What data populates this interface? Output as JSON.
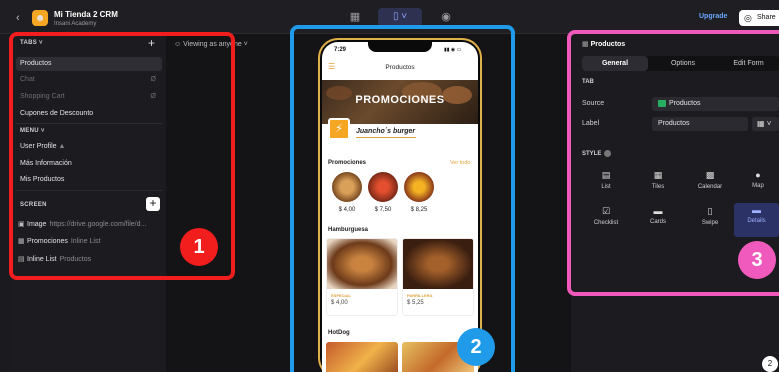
{
  "topbar": {
    "app_title": "Mi Tienda 2 CRM",
    "app_subtitle": "Insani Academy",
    "upgrade": "Upgrade",
    "share": "Share"
  },
  "left": {
    "tabs_header": "TABS",
    "tabs": [
      {
        "label": "Productos",
        "selected": true,
        "hidden": false
      },
      {
        "label": "Chat",
        "hidden": true
      },
      {
        "label": "Shopping Cart",
        "hidden": true
      },
      {
        "label": "Cupones de Descounto",
        "hidden": false
      }
    ],
    "menu_header": "MENU",
    "menu": [
      {
        "label": "User Profile"
      },
      {
        "label": "Más Información"
      },
      {
        "label": "Mis Productos"
      }
    ],
    "screen_header": "SCREEN",
    "screen": [
      {
        "label": "Image",
        "sub": "https://drive.google.com/file/d..."
      },
      {
        "label": "Promociones",
        "sub": "Inline List"
      },
      {
        "label": "Inline List",
        "sub": "Productos"
      }
    ]
  },
  "viewing": "Viewing as anyone",
  "phone": {
    "time": "7:29",
    "title": "Productos",
    "banner": "PROMOCIONES",
    "brand": "Juancho´s burger",
    "promo_header": "Promociones",
    "see_all": "Ver todo",
    "prices": [
      "$ 4,00",
      "$ 7,50",
      "$ 8,25"
    ],
    "hamburguesa_header": "Hamburguesa",
    "cards": [
      {
        "tag": "ESPECIAL",
        "price": "$ 4,00"
      },
      {
        "tag": "PARRILLERA",
        "price": "$ 5,25"
      }
    ],
    "hotdog_header": "HotDog"
  },
  "right": {
    "title": "Productos",
    "tabs": [
      "General",
      "Options",
      "Edit Form"
    ],
    "tab_header": "TAB",
    "source_label": "Source",
    "source_value": "Productos",
    "label_label": "Label",
    "label_value": "Productos",
    "style_header": "STYLE",
    "styles": [
      "List",
      "Tiles",
      "Calendar",
      "Map",
      "Checklist",
      "Cards",
      "Swipe",
      "Details"
    ]
  },
  "badges": [
    "1",
    "2",
    "3"
  ],
  "corner_badge": "2",
  "colors": {
    "red": "#f21d1d",
    "blue": "#1f9bea",
    "pink": "#f05abd",
    "accent": "#e0a33a"
  }
}
